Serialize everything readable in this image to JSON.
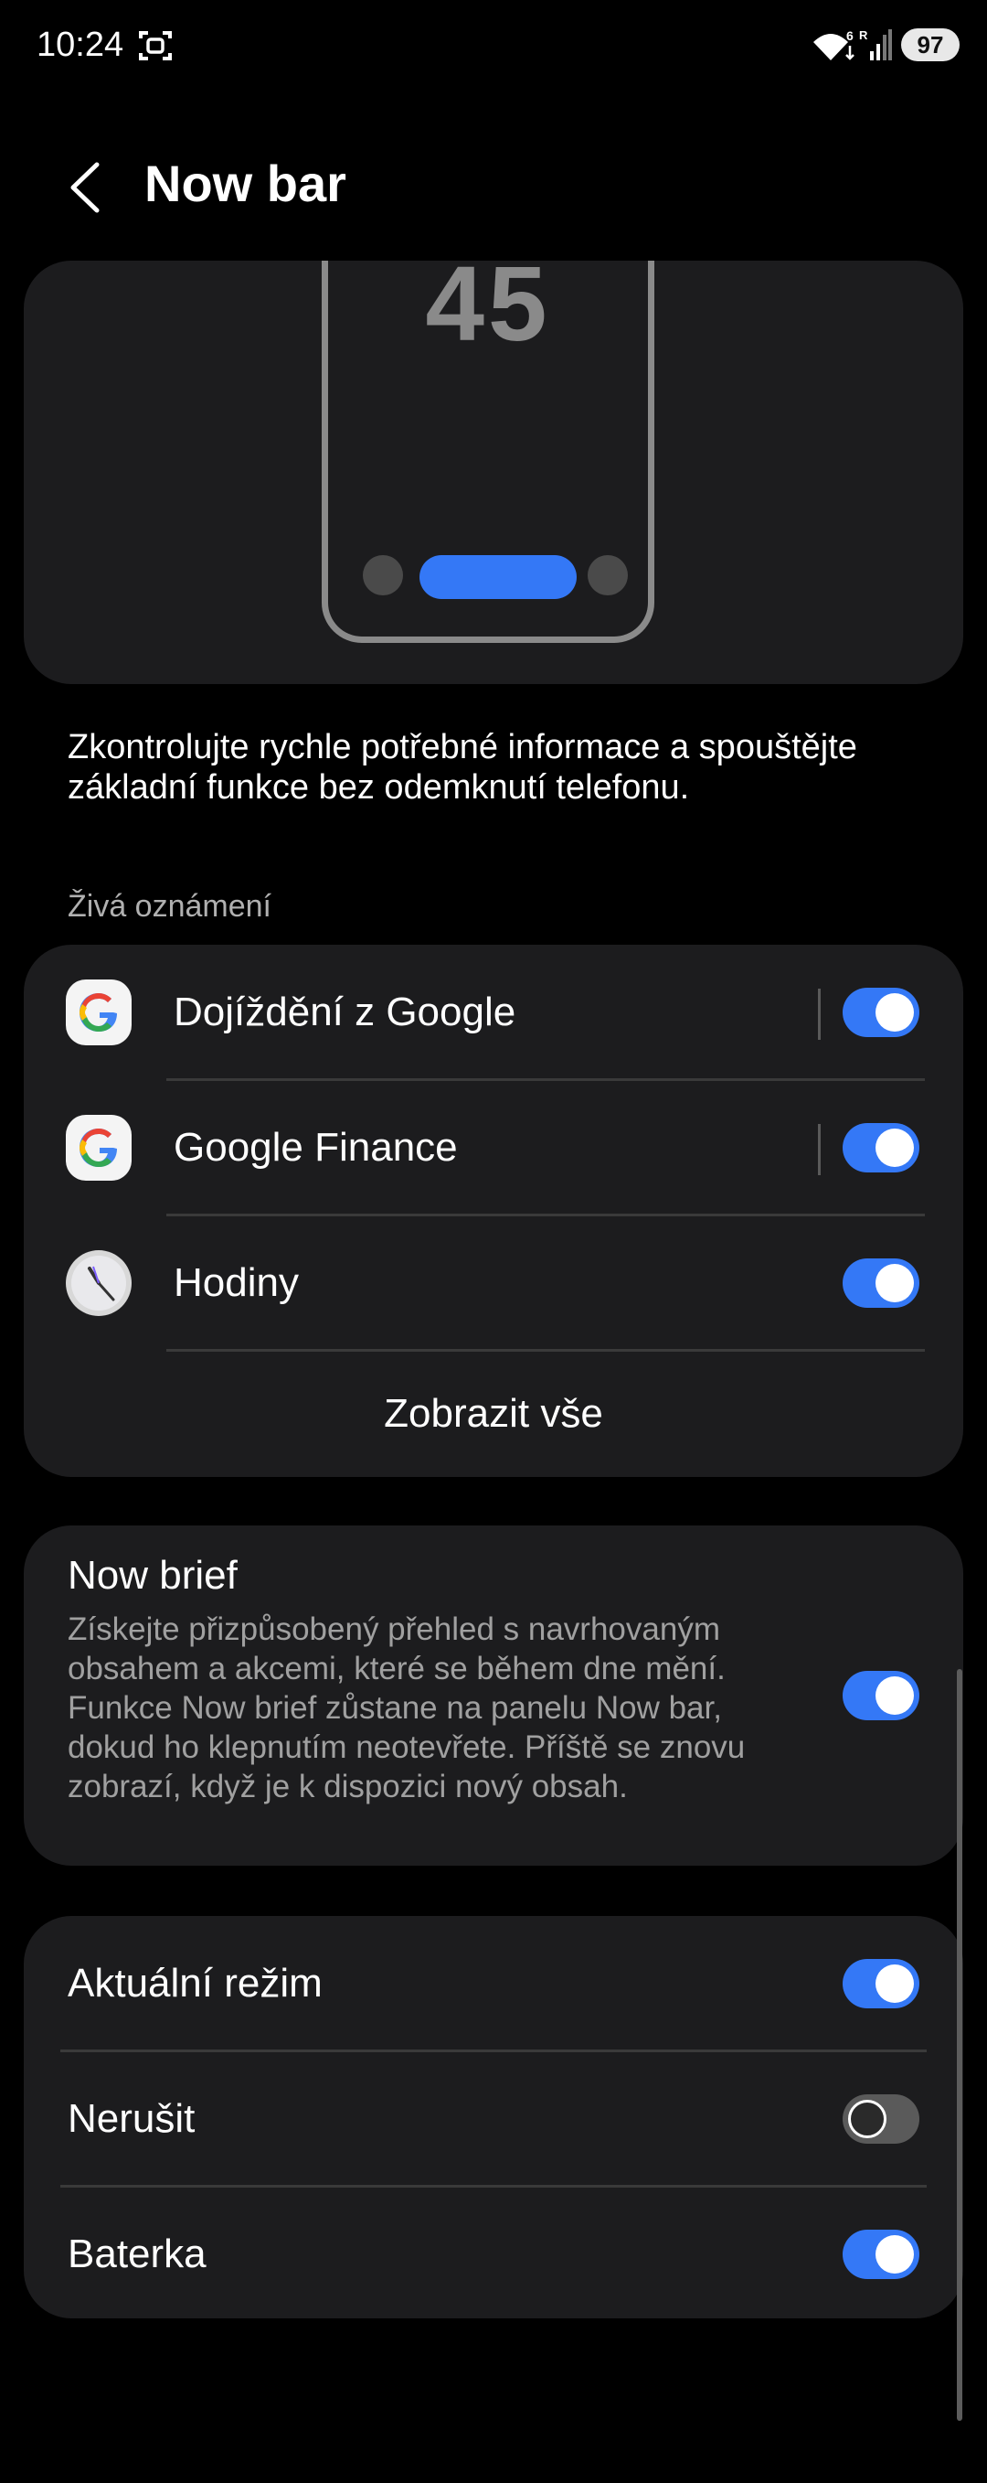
{
  "status_bar": {
    "time": "10:24",
    "battery": "97",
    "network_type": "6",
    "roaming": "R"
  },
  "header": {
    "title": "Now bar"
  },
  "preview": {
    "clock_number": "45"
  },
  "description": "Zkontrolujte rychle potřebné informace a spouštějte základní funkce bez odemknutí telefonu.",
  "live_notifications": {
    "section_title": "Živá oznámení",
    "items": [
      {
        "label": "Dojíždění z Google",
        "icon": "google-icon",
        "enabled": true
      },
      {
        "label": "Google Finance",
        "icon": "google-icon",
        "enabled": true
      },
      {
        "label": "Hodiny",
        "icon": "clock-icon",
        "enabled": true
      }
    ],
    "show_all": "Zobrazit vše"
  },
  "now_brief": {
    "title": "Now brief",
    "description": "Získejte přizpůsobený přehled s navrhovaným obsahem a akcemi, které se během dne mění. Funkce Now brief zůstane na panelu Now bar, dokud ho klepnutím neotevřete. Příště se znovu zobrazí, když je k dispozici nový obsah.",
    "enabled": true
  },
  "other_settings": [
    {
      "label": "Aktuální režim",
      "enabled": true
    },
    {
      "label": "Nerušit",
      "enabled": false
    },
    {
      "label": "Baterka",
      "enabled": true
    }
  ],
  "colors": {
    "accent": "#3478f6",
    "card_bg": "#1c1c1e",
    "background": "#000000"
  }
}
